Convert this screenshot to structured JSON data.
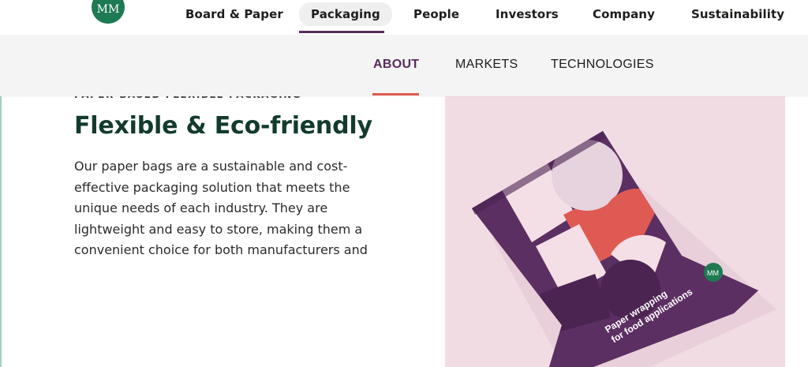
{
  "header": {
    "logo_text": "MM",
    "nav_items": [
      {
        "label": "Board & Paper",
        "active": false
      },
      {
        "label": "Packaging",
        "active": true
      },
      {
        "label": "People",
        "active": false
      },
      {
        "label": "Investors",
        "active": false
      },
      {
        "label": "Company",
        "active": false
      },
      {
        "label": "Sustainability",
        "active": false
      }
    ]
  },
  "subnav": {
    "items": [
      {
        "label": "ABOUT",
        "active": true
      },
      {
        "label": "MARKETS",
        "active": false
      },
      {
        "label": "TECHNOLOGIES",
        "active": false
      }
    ]
  },
  "main": {
    "eyebrow": "PAPER-BASED FLEXIBLE PACKAGING",
    "title": "Flexible & Eco-friendly",
    "body": "Our paper bags are a sustainable and cost-effective packaging solution that meets the unique needs of each industry. They are lightweight and easy to store, making them a convenient choice for both manufacturers and"
  },
  "product_image": {
    "bag_text_line1": "Paper wrapping",
    "bag_text_line2": "for food applications",
    "bag_logo": "MM"
  },
  "colors": {
    "brand_green": "#1d7a52",
    "purple": "#5a2b5d",
    "coral": "#e05a4f",
    "pink_bg": "#f1dce4"
  }
}
